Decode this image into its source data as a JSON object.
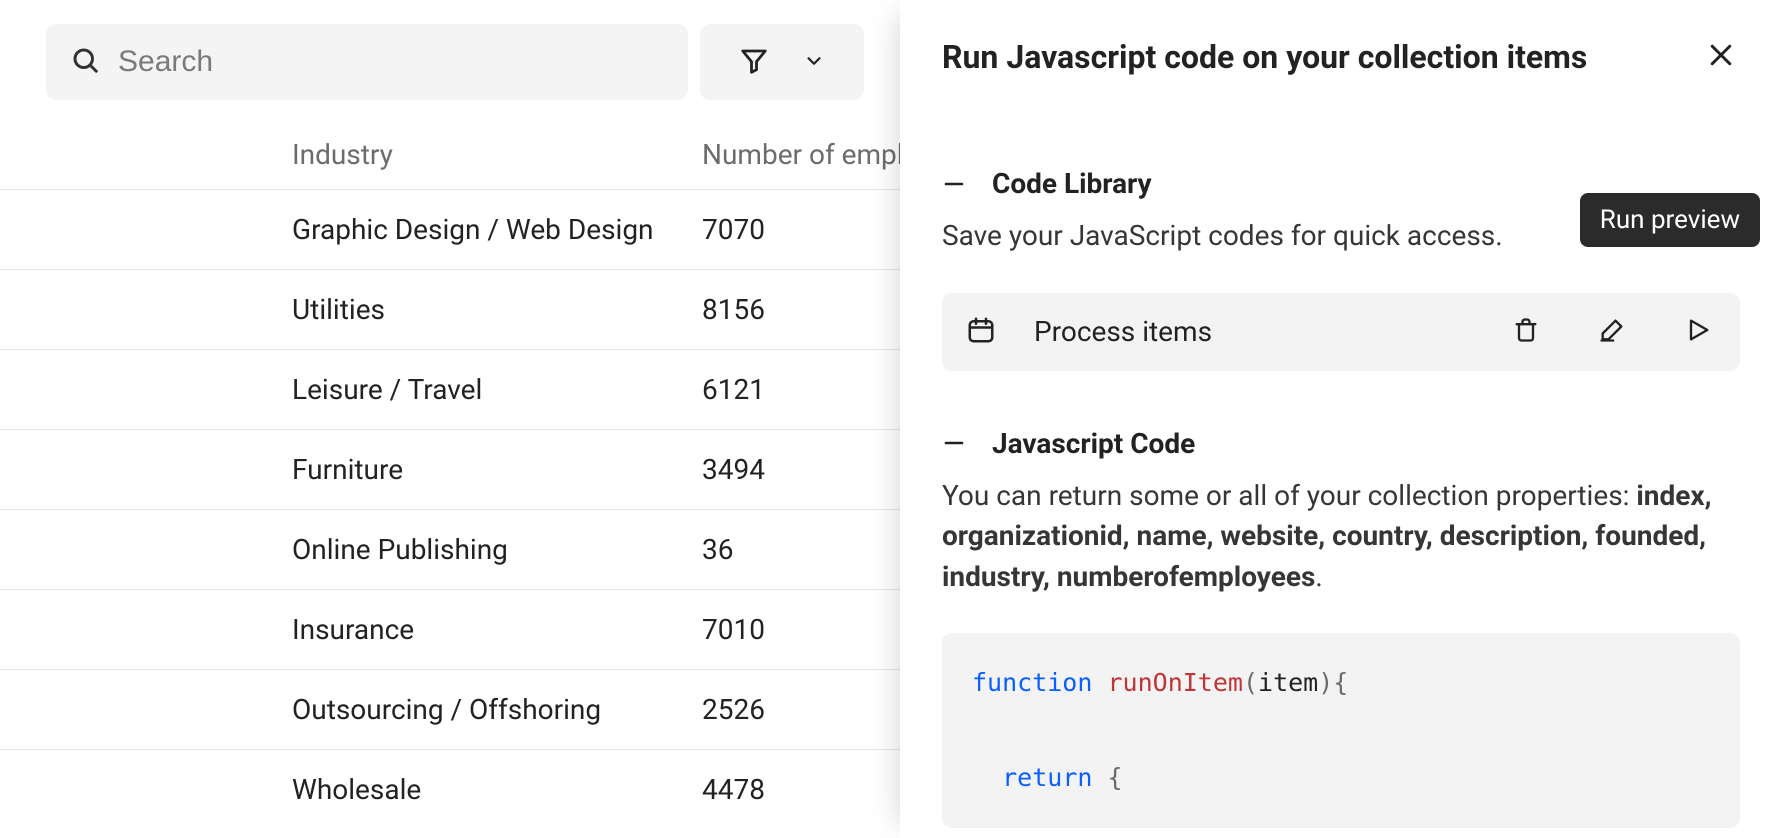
{
  "toolbar": {
    "search_placeholder": "Search"
  },
  "table": {
    "columns": {
      "industry": "Industry",
      "employees": "Number of empl"
    },
    "rows": [
      {
        "industry": "Graphic Design / Web Design",
        "employees": "7070"
      },
      {
        "industry": "Utilities",
        "employees": "8156"
      },
      {
        "industry": "Leisure / Travel",
        "employees": "6121"
      },
      {
        "industry": "Furniture",
        "employees": "3494"
      },
      {
        "industry": "Online Publishing",
        "employees": "36"
      },
      {
        "industry": "Insurance",
        "employees": "7010"
      },
      {
        "industry": "Outsourcing / Offshoring",
        "employees": "2526"
      },
      {
        "industry": "Wholesale",
        "employees": "4478"
      }
    ]
  },
  "panel": {
    "title": "Run Javascript code on your collection items",
    "tooltip_run_preview": "Run preview",
    "code_library": {
      "heading": "Code Library",
      "desc": "Save your JavaScript codes for quick access.",
      "item_name": "Process items"
    },
    "js_code": {
      "heading": "Javascript Code",
      "desc_prefix": "You can return some or all of your collection properties: ",
      "props": "index,  organizationid,  name,  website,  country,  description,  founded,  industry,  numberofemployees",
      "desc_suffix": ".",
      "code": {
        "kw_function": "function",
        "fn_name": "runOnItem",
        "arg": "item",
        "brace_open": "{",
        "kw_return": "return",
        "obj_open": "{"
      }
    }
  }
}
